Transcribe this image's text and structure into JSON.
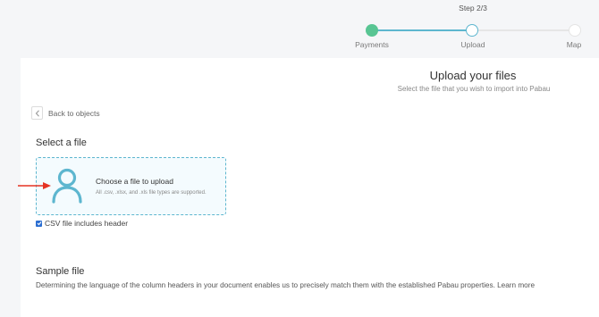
{
  "stepper": {
    "step_count": "Step 2/3",
    "steps": [
      {
        "label": "Payments",
        "state": "complete",
        "color": "#58c593"
      },
      {
        "label": "Upload",
        "state": "current",
        "color": "#5db6cf"
      },
      {
        "label": "Map",
        "state": "pending",
        "color": "#e4e4e4"
      }
    ]
  },
  "header": {
    "title": "Upload your files",
    "subtitle": "Select the file that you wish to import into Pabau"
  },
  "back": {
    "label": "Back to objects",
    "icon": "chevron-left-icon"
  },
  "select_file": {
    "title": "Select a file",
    "dropzone_title": "Choose a file to upload",
    "dropzone_hint": "All .csv, .xlsx, and .xls file types are supported.",
    "icon": "user-icon",
    "accent": "#5db6cf"
  },
  "csv_header": {
    "label": "CSV file includes header",
    "checked": true
  },
  "sample_file": {
    "title": "Sample file",
    "description": "Determining the language of the column headers in your document enables us to precisely match them with the established Pabau properties.",
    "link_label": "Learn more"
  },
  "annotation": {
    "arrow_color": "#e53323"
  }
}
